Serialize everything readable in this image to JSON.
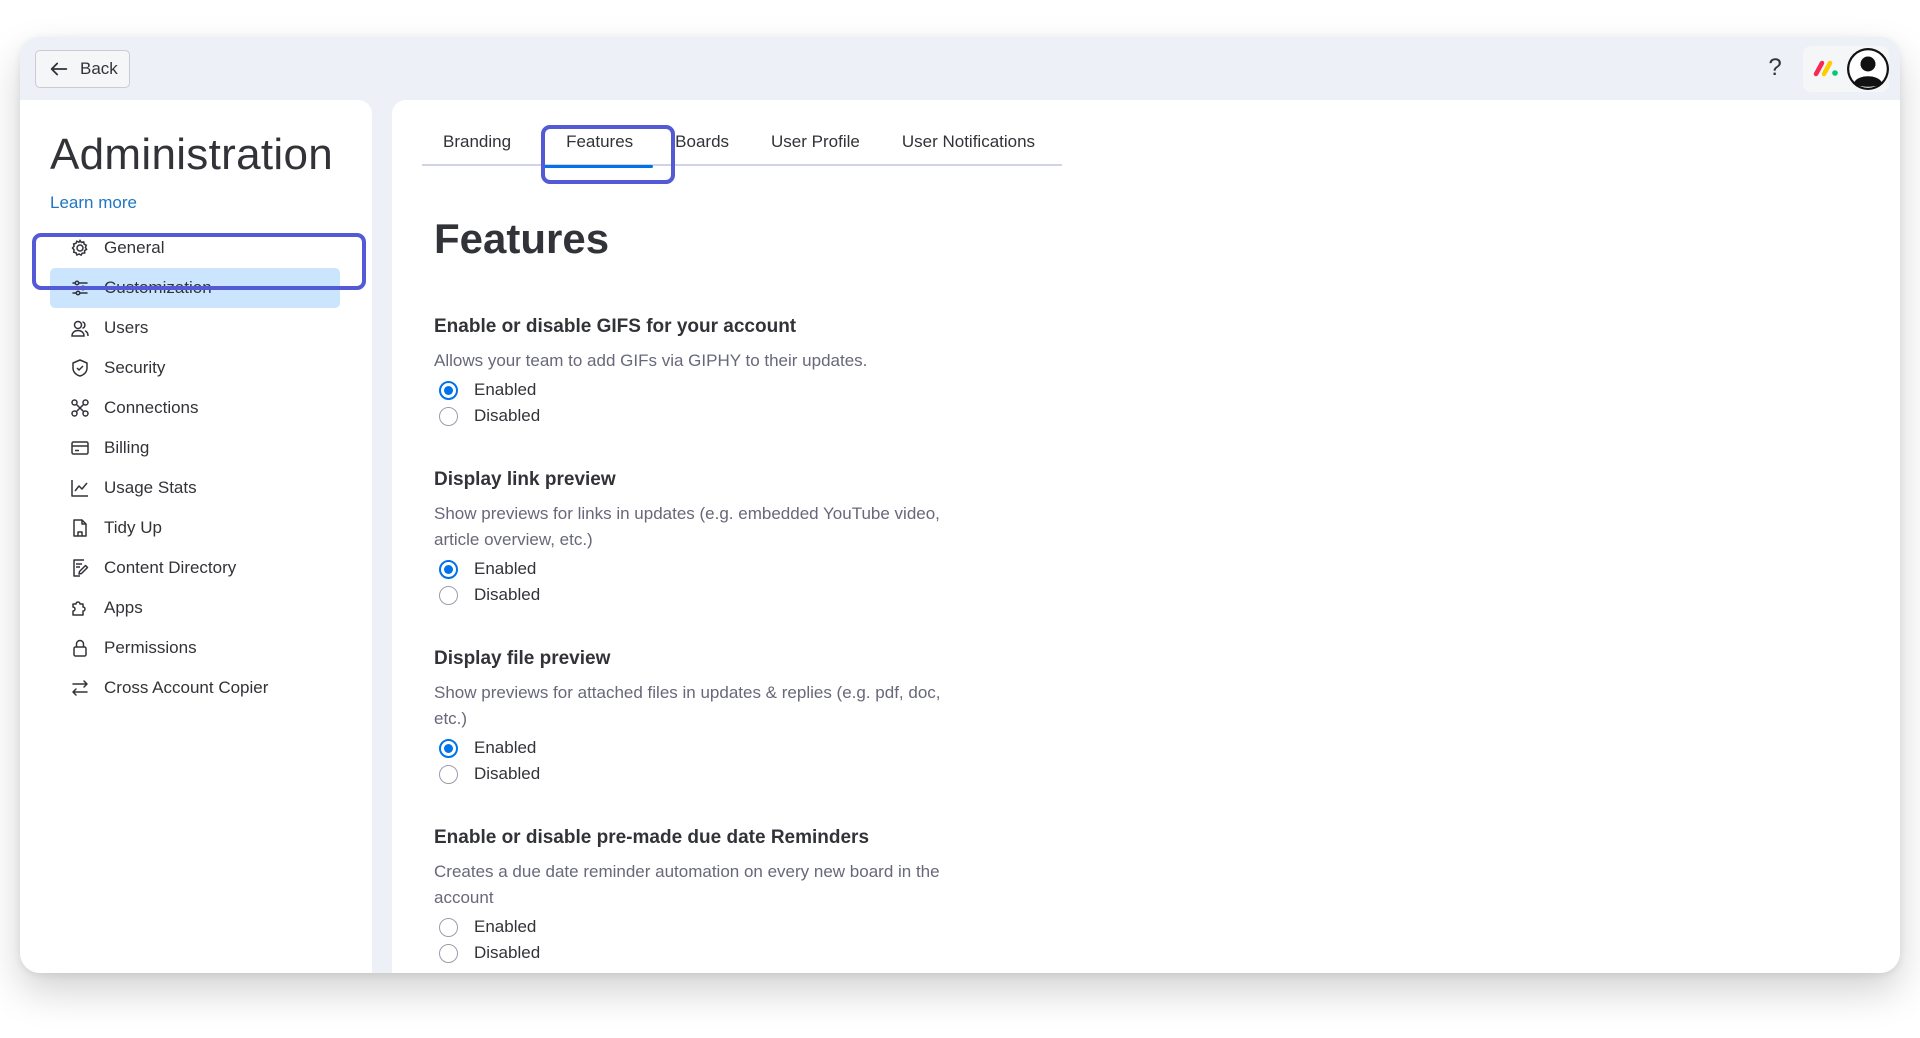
{
  "topbar": {
    "back_label": "Back",
    "help_label": "?"
  },
  "sidebar": {
    "title": "Administration",
    "learn_more": "Learn more",
    "items": [
      {
        "label": "General",
        "icon": "gear-icon"
      },
      {
        "label": "Customization",
        "icon": "sliders-icon",
        "selected": true
      },
      {
        "label": "Users",
        "icon": "users-icon"
      },
      {
        "label": "Security",
        "icon": "shield-icon"
      },
      {
        "label": "Connections",
        "icon": "connections-icon"
      },
      {
        "label": "Billing",
        "icon": "credit-card-icon"
      },
      {
        "label": "Usage Stats",
        "icon": "chart-icon"
      },
      {
        "label": "Tidy Up",
        "icon": "broom-icon"
      },
      {
        "label": "Content Directory",
        "icon": "edit-document-icon"
      },
      {
        "label": "Apps",
        "icon": "puzzle-icon"
      },
      {
        "label": "Permissions",
        "icon": "lock-icon"
      },
      {
        "label": "Cross Account Copier",
        "icon": "arrows-icon"
      }
    ]
  },
  "main": {
    "tabs": [
      {
        "label": "Branding"
      },
      {
        "label": "Features",
        "active": true
      },
      {
        "label": "Boards"
      },
      {
        "label": "User Profile"
      },
      {
        "label": "User Notifications"
      }
    ],
    "page_title": "Features",
    "settings": [
      {
        "title": "Enable or disable GIFS for your account",
        "description": "Allows your team to add GIFs via GIPHY to their updates.",
        "options": [
          "Enabled",
          "Disabled"
        ],
        "selected": "Enabled"
      },
      {
        "title": "Display link preview",
        "description": "Show previews for links in updates (e.g. embedded YouTube video, article overview, etc.)",
        "options": [
          "Enabled",
          "Disabled"
        ],
        "selected": "Enabled"
      },
      {
        "title": "Display file preview",
        "description": "Show previews for attached files in updates & replies (e.g. pdf, doc, etc.)",
        "options": [
          "Enabled",
          "Disabled"
        ],
        "selected": "Enabled"
      },
      {
        "title": "Enable or disable pre-made due date Reminders",
        "description": "Creates a due date reminder automation on every new board in the account",
        "options": [
          "Enabled",
          "Disabled"
        ],
        "selected": ""
      }
    ]
  },
  "colors": {
    "accent": "#0073ea",
    "highlight_outline": "#5459d6",
    "selected_bg": "#cce5ff",
    "link": "#1f76c2"
  }
}
